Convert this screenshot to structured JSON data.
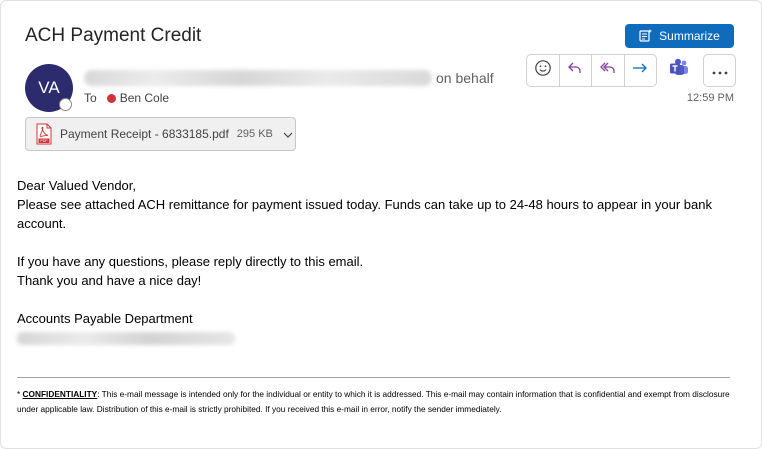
{
  "email": {
    "subject": "ACH Payment Credit",
    "summarize_label": "Summarize",
    "sender_initials": "VA",
    "on_behalf": "on behalf",
    "to_prefix": "To",
    "recipient": "Ben Cole",
    "time": "12:59 PM",
    "attachment": {
      "name": "Payment Receipt - 6833185.pdf",
      "size": "295 KB",
      "icon": "pdf-icon"
    },
    "body": {
      "greeting": "Dear Valued Vendor,",
      "line1": "Please see attached ACH remittance for payment issued today.  Funds can take up to 24-48 hours to appear in your bank account.",
      "line2": "If you have any questions, please reply directly to this email.",
      "line3": "Thank you and have a nice day!",
      "signature": "Accounts Payable Department"
    },
    "confidentiality": {
      "prefix": "* ",
      "label": "CONFIDENTIALITY",
      "text": ":  This e-mail message is intended only for the individual or entity to which it is addressed. This e-mail may contain information that is confidential and exempt from disclosure under applicable law. Distribution of this e-mail is strictly prohibited. If you received this e-mail in error, notify the sender immediately."
    }
  },
  "toolbar_icons": [
    "emoji-icon",
    "reply-icon",
    "reply-all-icon",
    "forward-icon",
    "teams-icon",
    "more-icon"
  ],
  "colors": {
    "accent": "#0f6cbd",
    "avatar": "#2b2b6e",
    "reply": "#8a3fa3",
    "forward": "#0f6cbd",
    "pdf": "#d13438",
    "presence_busy": "#d13438"
  }
}
